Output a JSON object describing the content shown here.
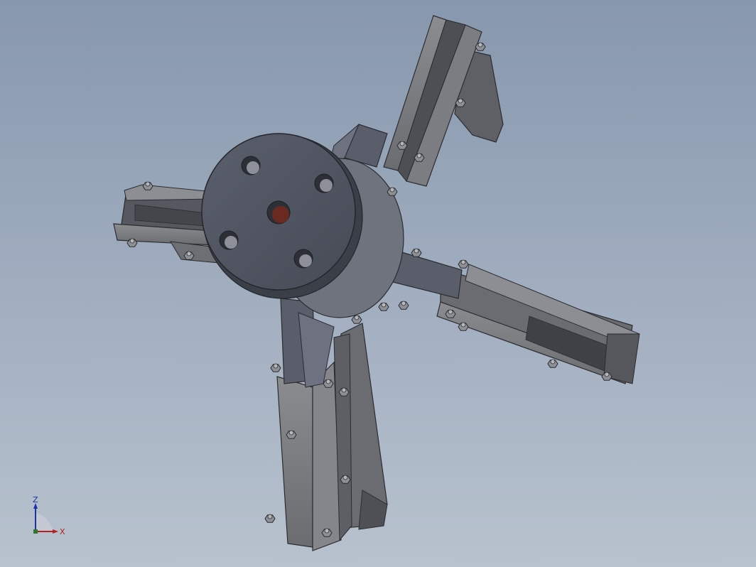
{
  "viewport": {
    "background_top": "#8797ad",
    "background_bottom": "#b8c2ce"
  },
  "model": {
    "arm_count": 4,
    "body_color": "#6b6f78",
    "hub_color": "#4d525e",
    "center_hole_color": "#6a2a22",
    "bolt_hole_count": 4
  },
  "triad": {
    "z_label": "Z",
    "x_label": "X",
    "z_color": "#1c2fa8",
    "x_color": "#b42121"
  }
}
